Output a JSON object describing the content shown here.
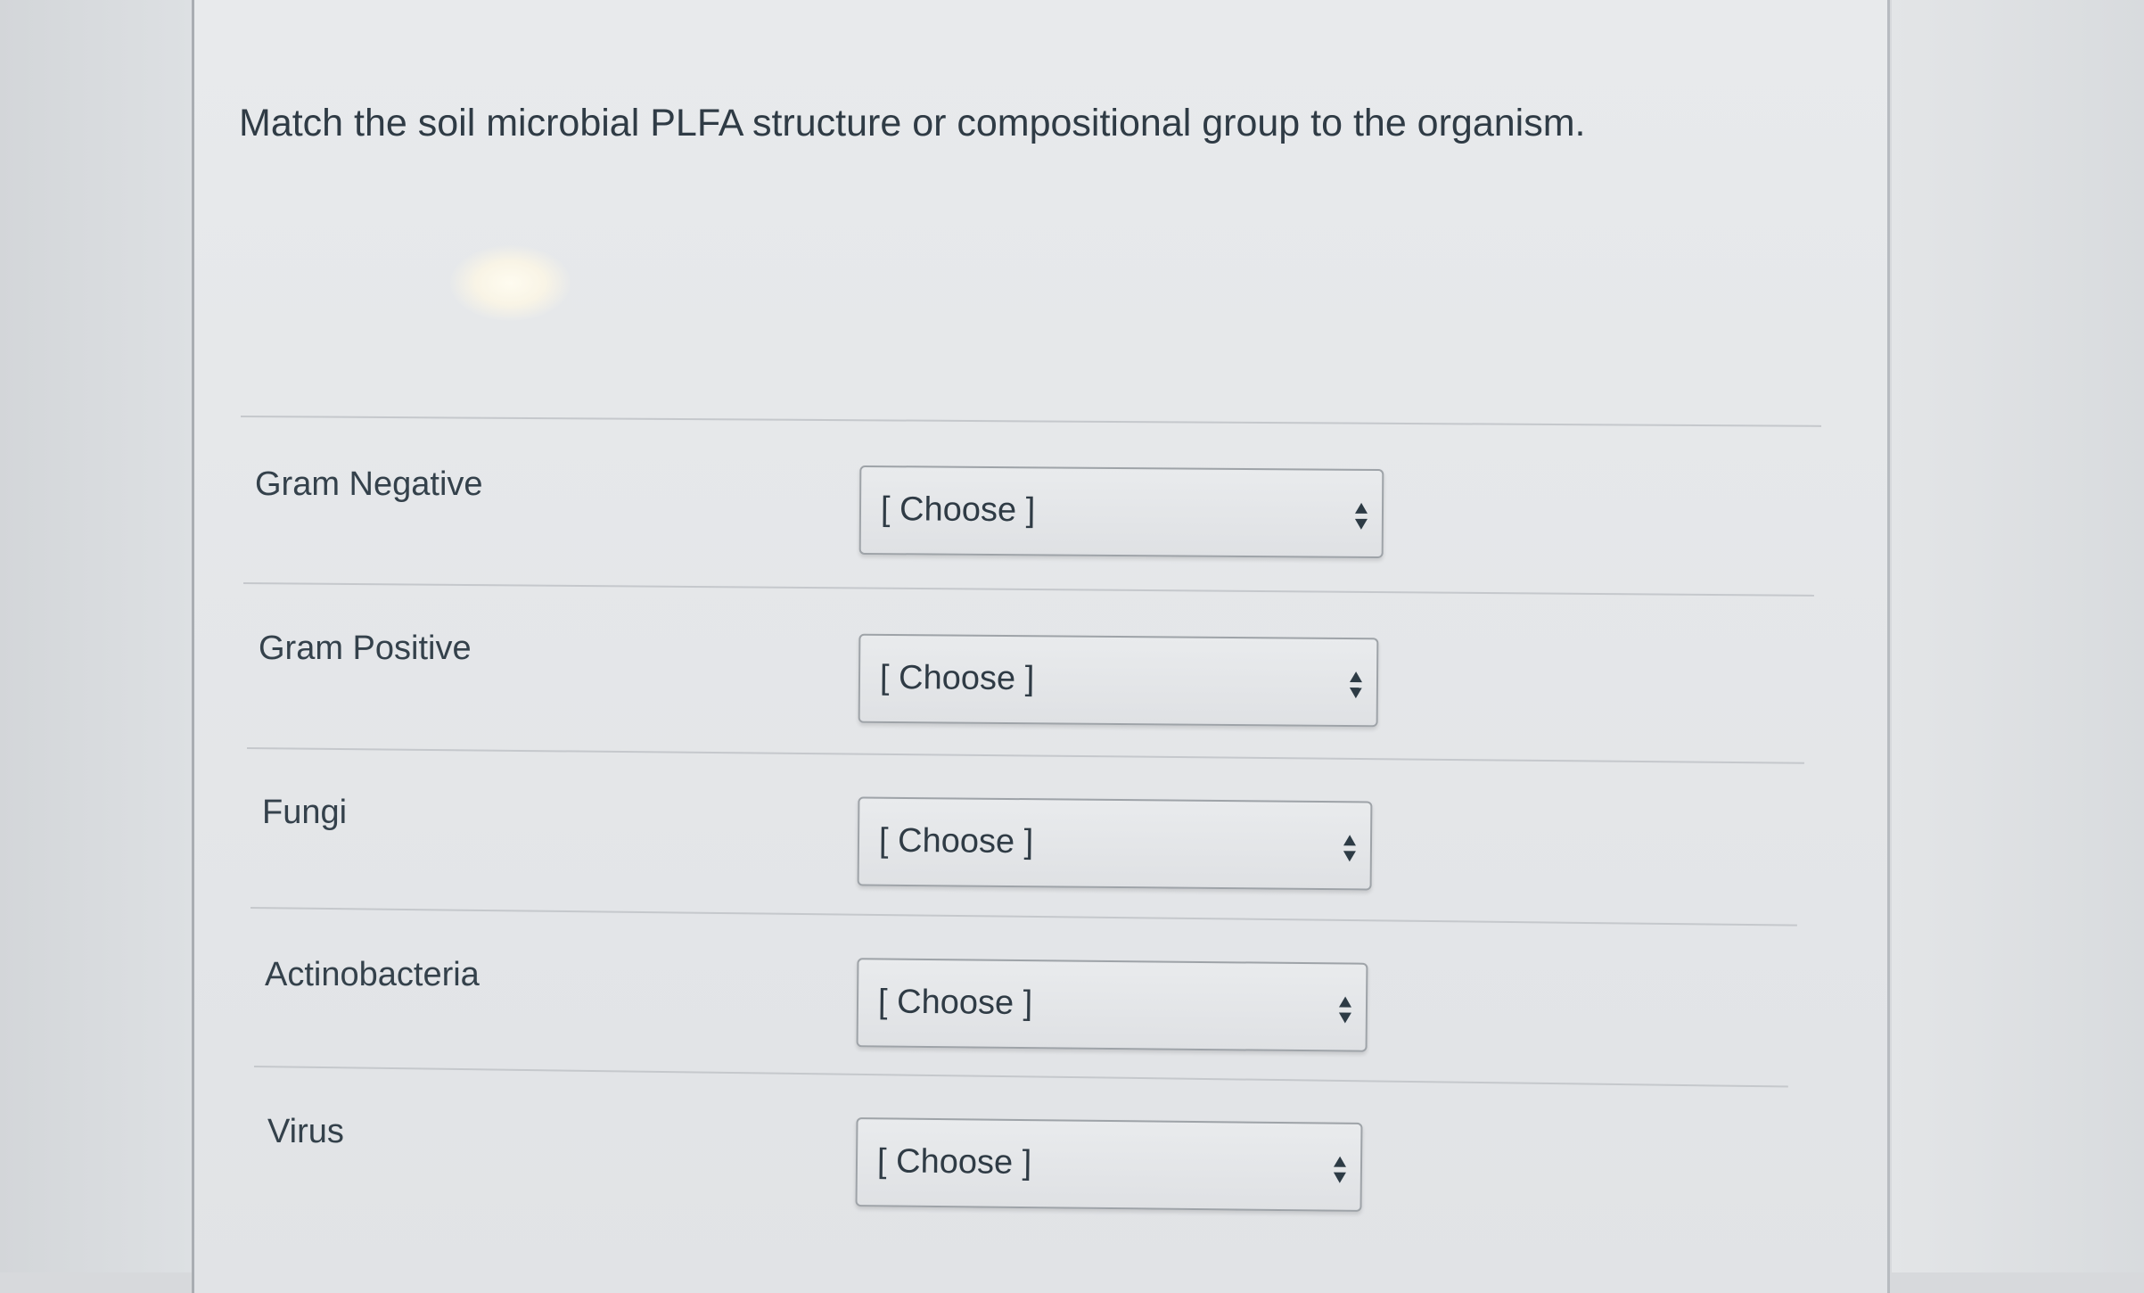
{
  "question": {
    "text": "Match the soil microbial PLFA structure or compositional group to the organism."
  },
  "matching_rows": [
    {
      "label": "Gram Negative",
      "selected": "[ Choose ]"
    },
    {
      "label": "Gram Positive",
      "selected": "[ Choose ]"
    },
    {
      "label": "Fungi",
      "selected": "[ Choose ]"
    },
    {
      "label": "Actinobacteria",
      "selected": "[ Choose ]"
    },
    {
      "label": "Virus",
      "selected": "[ Choose ]"
    }
  ],
  "icons": {
    "dropdown_arrows": "sort-updown-icon"
  }
}
